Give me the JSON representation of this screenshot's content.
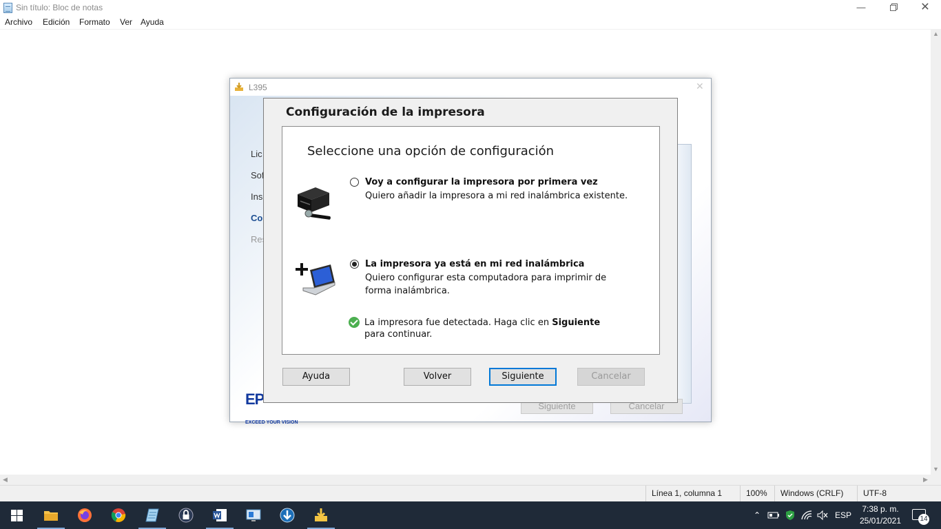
{
  "notepad": {
    "title": "Sin título: Bloc de notas",
    "menu": [
      "Archivo",
      "Edición",
      "Formato",
      "Ver",
      "Ayuda"
    ],
    "status": {
      "position": "Línea 1, columna 1",
      "zoom": "100%",
      "line_ending": "Windows (CRLF)",
      "encoding": "UTF-8"
    }
  },
  "installer": {
    "title": "L395",
    "steps": [
      "Lic",
      "Sof",
      "Ins",
      "Co",
      "Res"
    ],
    "brand": "EP",
    "tagline": "EXCEED YOUR VISION",
    "buttons": {
      "next": "Siguiente",
      "cancel": "Cancelar"
    }
  },
  "dialog": {
    "heading": "Configuración de la impresora",
    "panel_title": "Seleccione una opción de configuración",
    "options": [
      {
        "title": "Voy a configurar la impresora por primera vez",
        "desc_lines": [
          "Quiero añadir la impresora a mi red inalámbrica existente."
        ],
        "checked": false,
        "icon": "printer-setup-icon"
      },
      {
        "title": "La impresora ya está en mi red inalámbrica",
        "desc_lines": [
          "Quiero configurar esta computadora para imprimir de",
          "forma inalámbrica."
        ],
        "checked": true,
        "icon": "add-computer-icon"
      }
    ],
    "detected": {
      "text_before": "La impresora fue detectada. Haga clic en ",
      "bold": "Siguiente",
      "text_after": "para continuar."
    },
    "buttons": {
      "help": "Ayuda",
      "back": "Volver",
      "next": "Siguiente",
      "cancel": "Cancelar"
    }
  },
  "taskbar": {
    "apps": [
      "start-icon",
      "file-explorer-icon",
      "firefox-icon",
      "chrome-icon",
      "notepad-icon",
      "lock-app-icon",
      "word-icon",
      "remote-desktop-icon",
      "download-icon",
      "epson-installer-icon"
    ],
    "language": "ESP",
    "time": "7:38 p. m.",
    "date": "25/01/2021",
    "notification_count": "14"
  },
  "colors": {
    "accent": "#0078d7",
    "taskbar": "#1f2a38",
    "epson_blue": "#12399e",
    "success": "#4caf50"
  }
}
